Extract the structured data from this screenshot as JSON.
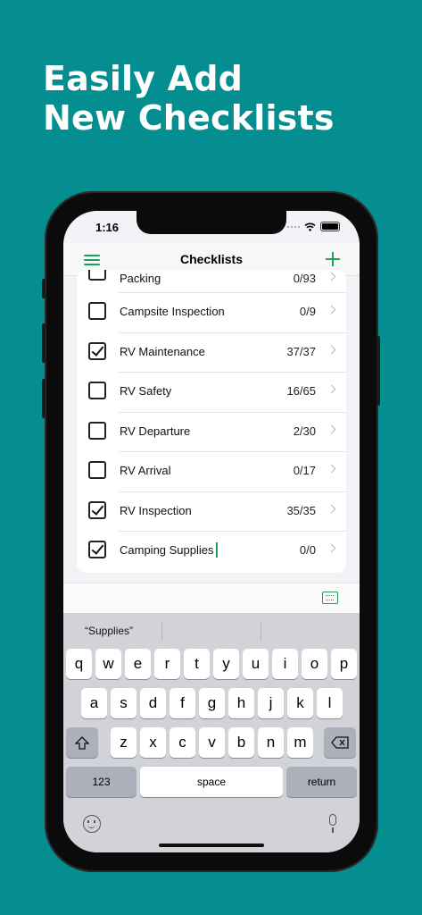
{
  "headline": {
    "line1": "Easily Add",
    "line2": "New Checklists"
  },
  "status_bar": {
    "time": "1:16"
  },
  "nav": {
    "title": "Checklists"
  },
  "checklists": [
    {
      "label": "Packing",
      "count": "0/93",
      "checked": false
    },
    {
      "label": "Campsite Inspection",
      "count": "0/9",
      "checked": false
    },
    {
      "label": "RV Maintenance",
      "count": "37/37",
      "checked": true
    },
    {
      "label": "RV Safety",
      "count": "16/65",
      "checked": false
    },
    {
      "label": "RV Departure",
      "count": "2/30",
      "checked": false
    },
    {
      "label": "RV Arrival",
      "count": "0/17",
      "checked": false
    },
    {
      "label": "RV Inspection",
      "count": "35/35",
      "checked": true
    },
    {
      "label": "Camping Supplies",
      "count": "0/0",
      "checked": true
    }
  ],
  "keyboard": {
    "suggestion": "“Supplies”",
    "row1": [
      "q",
      "w",
      "e",
      "r",
      "t",
      "y",
      "u",
      "i",
      "o",
      "p"
    ],
    "row2": [
      "a",
      "s",
      "d",
      "f",
      "g",
      "h",
      "j",
      "k",
      "l"
    ],
    "row3": [
      "z",
      "x",
      "c",
      "v",
      "b",
      "n",
      "m"
    ],
    "numbers_label": "123",
    "space_label": "space",
    "return_label": "return"
  },
  "colors": {
    "background": "#048e8f",
    "accent": "#1e9e5e"
  },
  "icons": [
    "menu-icon",
    "add-icon",
    "checkbox-icon",
    "chevron-right-icon",
    "keyboard-dismiss-icon",
    "shift-icon",
    "delete-icon",
    "emoji-icon",
    "mic-icon"
  ]
}
